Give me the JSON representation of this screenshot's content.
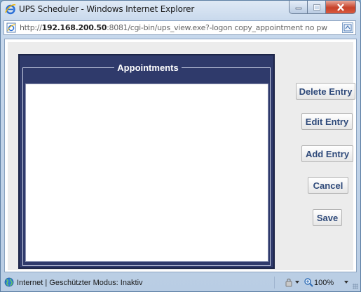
{
  "window": {
    "title": "UPS Scheduler - Windows Internet Explorer"
  },
  "address": {
    "url_prefix": "http://",
    "url_host": "192.168.200.50",
    "url_rest": ":8081/cgi-bin/ups_view.exe?-logon copy_appointment no pw"
  },
  "panel": {
    "legend": "Appointments"
  },
  "buttons": {
    "delete": "Delete Entry",
    "edit": "Edit Entry",
    "add": "Add Entry",
    "cancel": "Cancel",
    "save": "Save"
  },
  "status": {
    "text": "Internet | Geschützter Modus: Inaktiv",
    "zoom": "100%"
  },
  "icons": [
    "ie-logo-icon",
    "page-icon",
    "compat-view-icon",
    "globe-icon",
    "lock-icon",
    "zoom-icon"
  ],
  "colors": {
    "panel_bg": "#2f3a6b",
    "button_text": "#2f4a7a",
    "close_button": "#c6422a"
  }
}
